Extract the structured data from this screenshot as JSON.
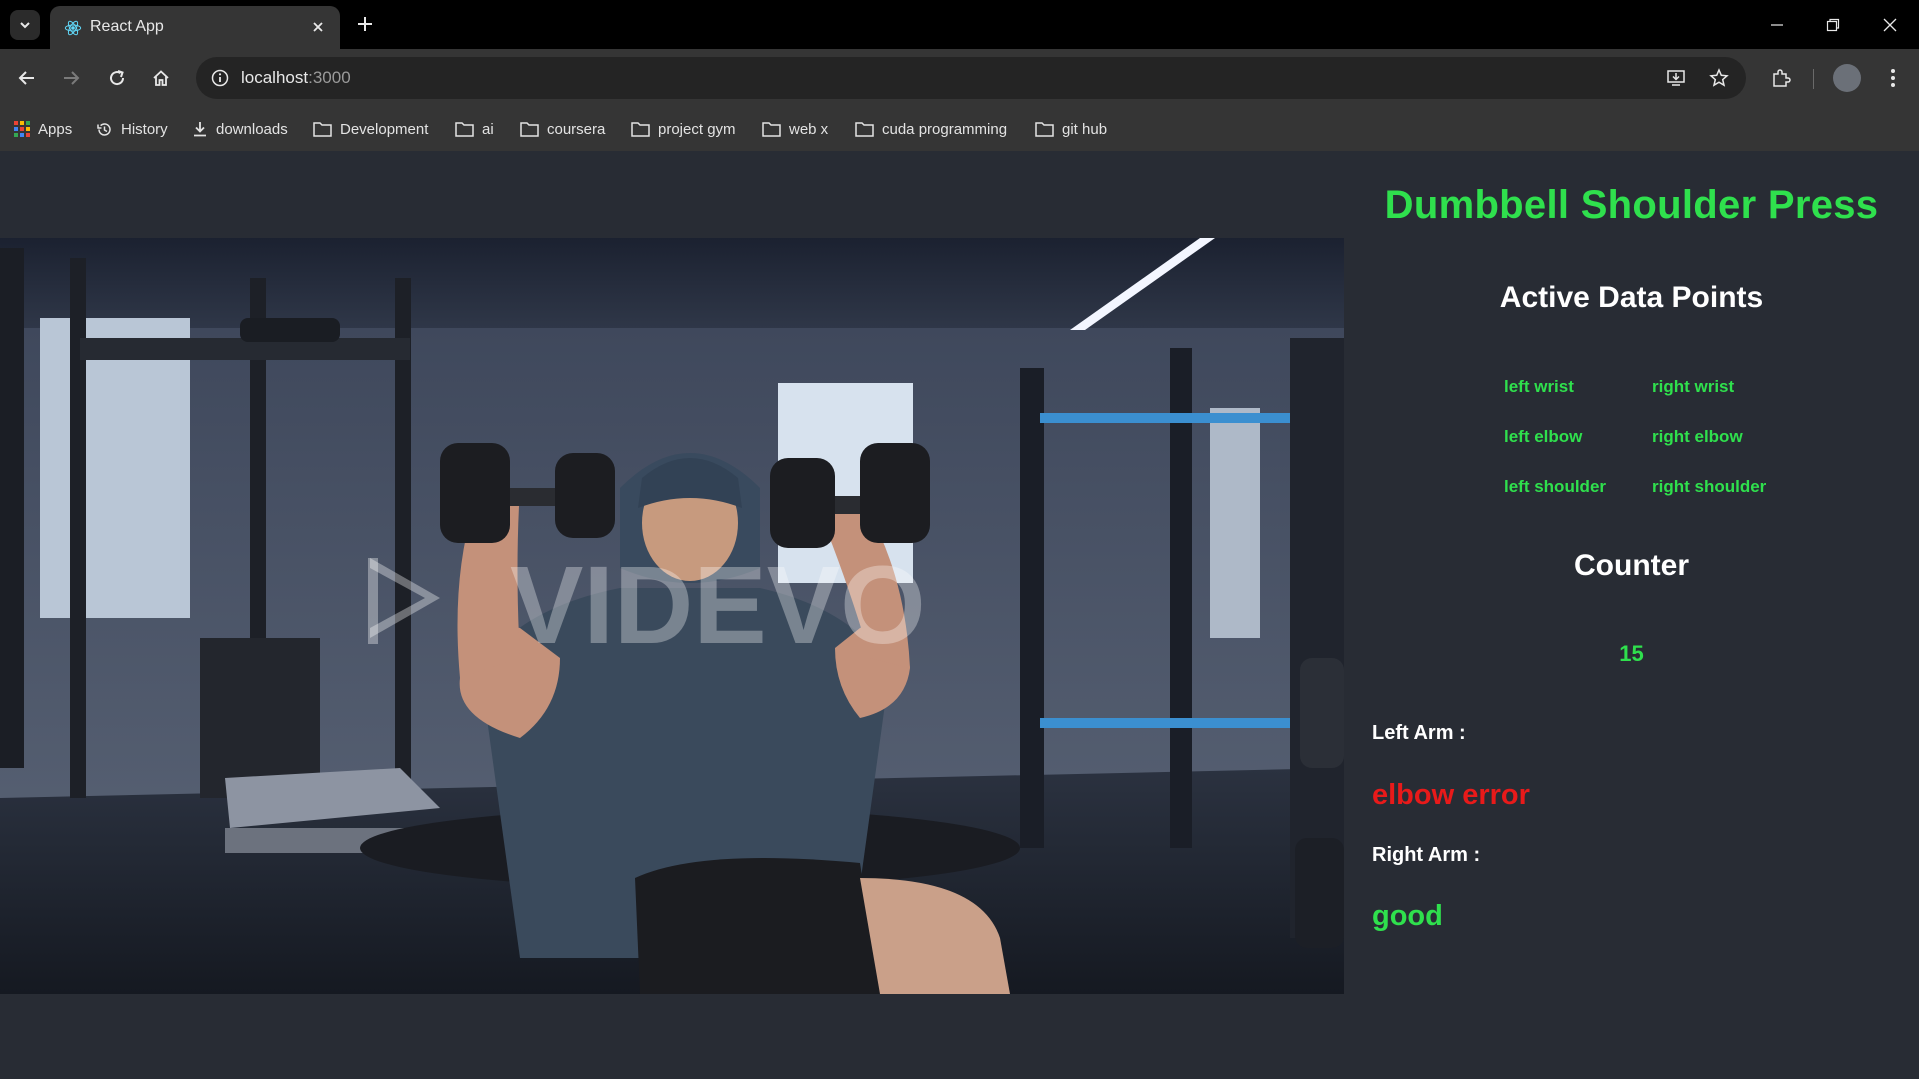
{
  "browser": {
    "tab_title": "React App",
    "url_host": "localhost",
    "url_port": ":3000",
    "bookmarks": [
      {
        "label": "Apps",
        "icon": "apps-grid-icon"
      },
      {
        "label": "History",
        "icon": "history-icon"
      },
      {
        "label": "downloads",
        "icon": "download-icon"
      },
      {
        "label": "Development",
        "icon": "folder-icon"
      },
      {
        "label": "ai",
        "icon": "folder-icon"
      },
      {
        "label": "coursera",
        "icon": "folder-icon"
      },
      {
        "label": "project gym",
        "icon": "folder-icon"
      },
      {
        "label": "web x",
        "icon": "folder-icon"
      },
      {
        "label": "cuda programming",
        "icon": "folder-icon"
      },
      {
        "label": "git hub",
        "icon": "folder-icon"
      }
    ]
  },
  "video": {
    "watermark": "VIDEVO"
  },
  "app": {
    "title": "Dumbbell Shoulder Press",
    "active_heading": "Active Data Points",
    "points": [
      "left wrist",
      "right wrist",
      "left elbow",
      "right elbow",
      "left shoulder",
      "right shoulder"
    ],
    "counter_heading": "Counter",
    "counter_value": "15",
    "left_arm_label": "Left Arm :",
    "left_arm_status": "elbow error",
    "right_arm_label": "Right Arm :",
    "right_arm_status": "good"
  },
  "colors": {
    "accent_green": "#2fe04d",
    "error_red": "#e81a1a",
    "page_bg": "#282c34"
  }
}
